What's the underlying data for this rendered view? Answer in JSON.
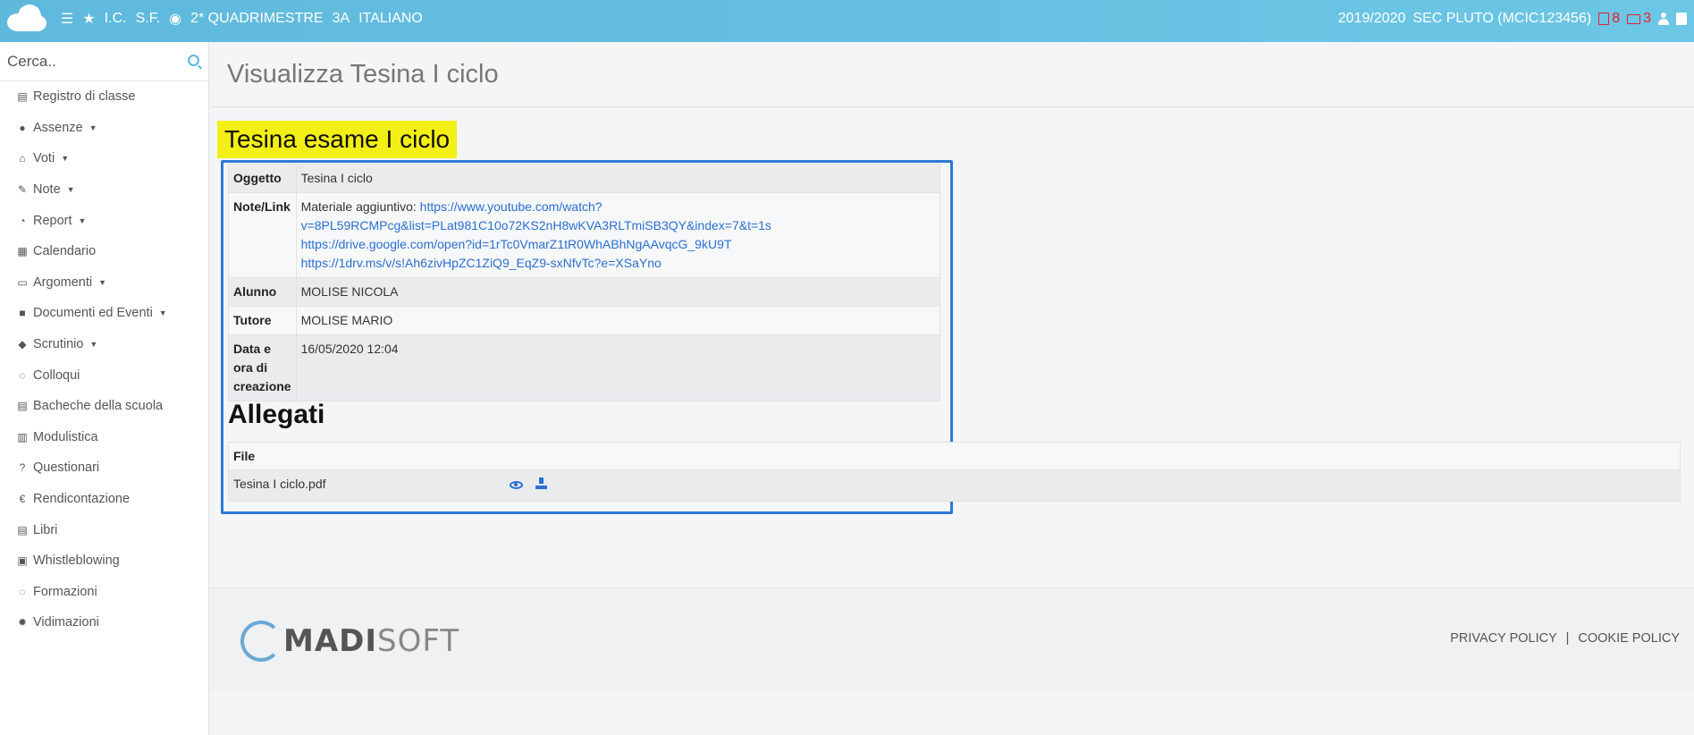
{
  "topbar": {
    "school": "I.C.",
    "school2": "S.F.",
    "period": "2* QUADRIMESTRE",
    "class": "3A",
    "subject": "ITALIANO",
    "year": "2019/2020",
    "user": "SEC PLUTO (MCIC123456)",
    "docs_count": "8",
    "mail_count": "3"
  },
  "sidebar": {
    "search_placeholder": "Cerca..",
    "items": [
      {
        "label": "Registro di classe",
        "icon": "book-icon",
        "glyph": "▤",
        "caret": ""
      },
      {
        "label": "Assenze",
        "icon": "user-icon",
        "glyph": "●",
        "caret": "▼"
      },
      {
        "label": "Voti",
        "icon": "institution-icon",
        "glyph": "⌂",
        "caret": "▼"
      },
      {
        "label": "Note",
        "icon": "pin-icon",
        "glyph": "✎",
        "caret": "▼"
      },
      {
        "label": "Report",
        "icon": "pie-chart-icon",
        "glyph": "◔",
        "caret": "▼"
      },
      {
        "label": "Calendario",
        "icon": "calendar-icon",
        "glyph": "▦",
        "caret": ""
      },
      {
        "label": "Argomenti",
        "icon": "folder-open-icon",
        "glyph": "▭",
        "caret": "▼"
      },
      {
        "label": "Documenti ed Eventi",
        "icon": "archive-icon",
        "glyph": "■",
        "caret": "▼"
      },
      {
        "label": "Scrutinio",
        "icon": "graduation-cap-icon",
        "glyph": "◆",
        "caret": "▼"
      },
      {
        "label": "Colloqui",
        "icon": "comments-icon",
        "glyph": "◌",
        "caret": ""
      },
      {
        "label": "Bacheche della scuola",
        "icon": "list-alt-icon",
        "glyph": "▤",
        "caret": ""
      },
      {
        "label": "Modulistica",
        "icon": "fax-icon",
        "glyph": "▥",
        "caret": ""
      },
      {
        "label": "Questionari",
        "icon": "question-icon",
        "glyph": "?",
        "caret": ""
      },
      {
        "label": "Rendicontazione",
        "icon": "euro-icon",
        "glyph": "€",
        "caret": ""
      },
      {
        "label": "Libri",
        "icon": "book-icon",
        "glyph": "▤",
        "caret": ""
      },
      {
        "label": "Whistleblowing",
        "icon": "lock-icon",
        "glyph": "▣",
        "caret": ""
      },
      {
        "label": "Formazioni",
        "icon": "comments-icon",
        "glyph": "◌",
        "caret": ""
      },
      {
        "label": "Vidimazioni",
        "icon": "certificate-icon",
        "glyph": "✹",
        "caret": ""
      }
    ]
  },
  "page": {
    "title": "Visualizza Tesina I ciclo",
    "doc_title": "Tesina esame I ciclo",
    "info": {
      "oggetto_label": "Oggetto",
      "oggetto_value": "Tesina I ciclo",
      "note_label": "Note/Link",
      "note_prefix": "Materiale aggiuntivo:",
      "link1a": "https://www.youtube.com/watch?",
      "link1b": "v=8PL59RCMPcg&list=PLat981C10o72KS2nH8wKVA3RLTmiSB3QY&index=7&t=1s",
      "link2": "https://drive.google.com/open?id=1rTc0VmarZ1tR0WhABhNgAAvqcG_9kU9T",
      "link3": "https://1drv.ms/v/s!Ah6zivHpZC1ZiQ9_EqZ9-sxNfvTc?e=XSaYno",
      "alunno_label": "Alunno",
      "alunno_value": "MOLISE NICOLA",
      "tutore_label": "Tutore",
      "tutore_value": "MOLISE MARIO",
      "data_label1": "Data e",
      "data_label2": "ora di",
      "data_label3": "creazione",
      "data_value": "16/05/2020 12:04"
    },
    "allegati_title": "Allegati",
    "files_header": "File",
    "files": [
      {
        "name": "Tesina I ciclo.pdf"
      }
    ]
  },
  "footer": {
    "logo_bold": "MADI",
    "logo_light": "SOFT",
    "privacy": "PRIVACY POLICY",
    "separator": "|",
    "cookie": "COOKIE POLICY"
  },
  "colors": {
    "topbar": "#5fb9dd",
    "highlight": "#f3ef16",
    "selection_border": "#2e79d8",
    "link": "#2a6fd1",
    "alert": "#e8202a"
  }
}
